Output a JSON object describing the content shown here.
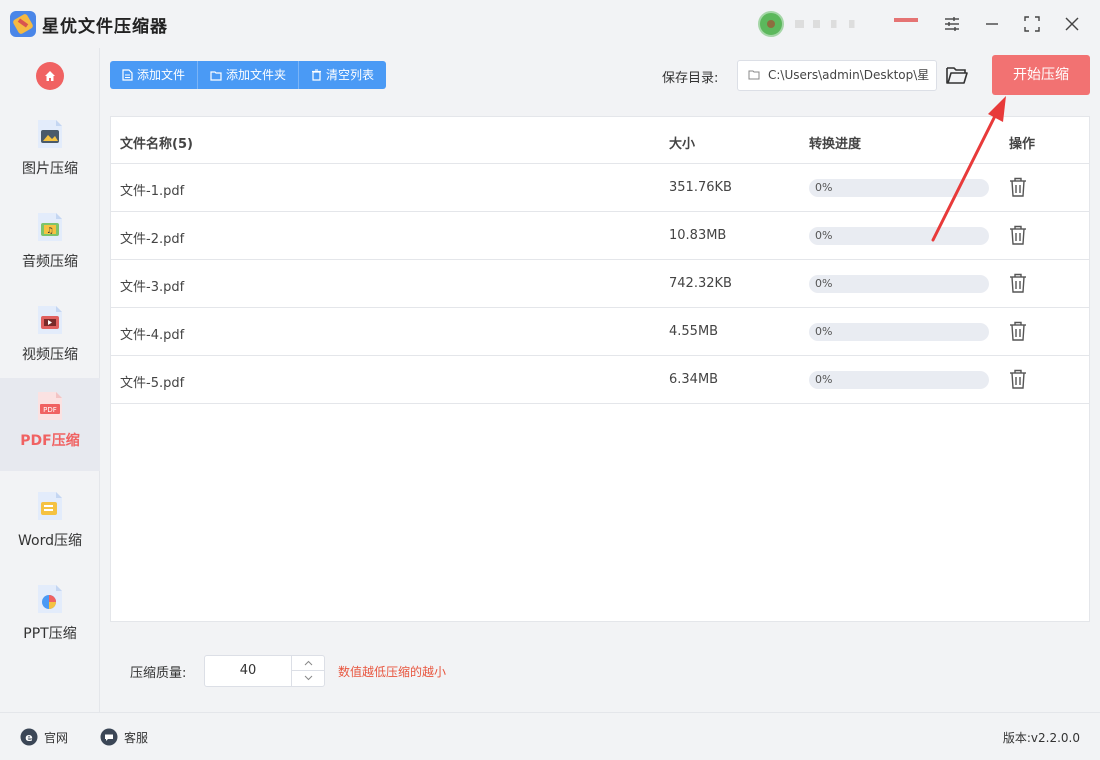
{
  "app": {
    "title": "星优文件压缩器"
  },
  "sidebar": {
    "items": [
      {
        "label": "图片压缩",
        "icon": "image-file-icon"
      },
      {
        "label": "音频压缩",
        "icon": "audio-file-icon"
      },
      {
        "label": "视频压缩",
        "icon": "video-file-icon"
      },
      {
        "label": "PDF压缩",
        "icon": "pdf-file-icon",
        "active": true
      },
      {
        "label": "Word压缩",
        "icon": "word-file-icon"
      },
      {
        "label": "PPT压缩",
        "icon": "ppt-file-icon"
      }
    ]
  },
  "toolbar": {
    "add_file": "添加文件",
    "add_folder": "添加文件夹",
    "clear_list": "清空列表",
    "save_dir_label": "保存目录:",
    "save_dir_value": "C:\\Users\\admin\\Desktop\\星",
    "start_label": "开始压缩"
  },
  "table": {
    "headers": {
      "name": "文件名称(5)",
      "size": "大小",
      "progress": "转换进度",
      "action": "操作"
    },
    "rows": [
      {
        "name": "文件-1.pdf",
        "size": "351.76KB",
        "progress_text": "0%",
        "progress": 0
      },
      {
        "name": "文件-2.pdf",
        "size": "10.83MB",
        "progress_text": "0%",
        "progress": 0
      },
      {
        "name": "文件-3.pdf",
        "size": "742.32KB",
        "progress_text": "0%",
        "progress": 0
      },
      {
        "name": "文件-4.pdf",
        "size": "4.55MB",
        "progress_text": "0%",
        "progress": 0
      },
      {
        "name": "文件-5.pdf",
        "size": "6.34MB",
        "progress_text": "0%",
        "progress": 0
      }
    ]
  },
  "settings": {
    "quality_label": "压缩质量:",
    "quality_value": "40",
    "quality_hint": "数值越低压缩的越小"
  },
  "footer": {
    "website": "官网",
    "support": "客服",
    "version": "版本:v2.2.0.0"
  },
  "colors": {
    "accent": "#4a9af5",
    "primary_action": "#f27272",
    "hint": "#e8563f"
  }
}
